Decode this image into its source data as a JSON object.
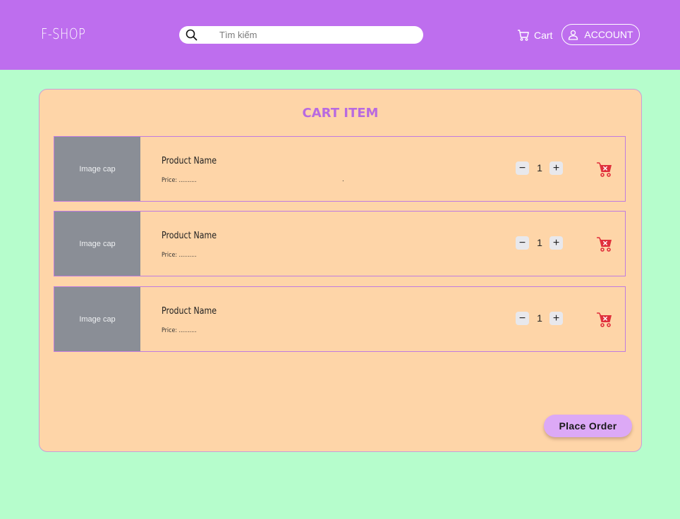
{
  "header": {
    "logo": "F-SHOP",
    "search_placeholder": "Tìm kiếm",
    "search_value": "",
    "cart_label": "Cart",
    "account_label": "ACCOUNT"
  },
  "cart": {
    "title": "CART ITEM",
    "items": [
      {
        "image_label": "Image cap",
        "name": "Product Name",
        "price": "Price: ..........",
        "quantity": "1",
        "minus_label": "−",
        "plus_label": "+",
        "note": "."
      },
      {
        "image_label": "Image cap",
        "name": "Product Name",
        "price": "Price: ..........",
        "quantity": "1",
        "minus_label": "−",
        "plus_label": "+"
      },
      {
        "image_label": "Image cap",
        "name": "Product Name",
        "price": "Price: ..........",
        "quantity": "1",
        "minus_label": "−",
        "plus_label": "+"
      }
    ],
    "place_order_label": "Place Order"
  },
  "colors": {
    "header_bg": "#be6eee",
    "page_bg": "#b6fdcc",
    "panel_bg": "#fed5a8",
    "accent": "#b86ae0",
    "remove_icon": "#e0303c",
    "button_bg": "#dca9f6"
  },
  "icons": {
    "search": "search-icon",
    "cart": "cart-icon",
    "account": "user-icon",
    "remove": "cart-remove-icon"
  }
}
